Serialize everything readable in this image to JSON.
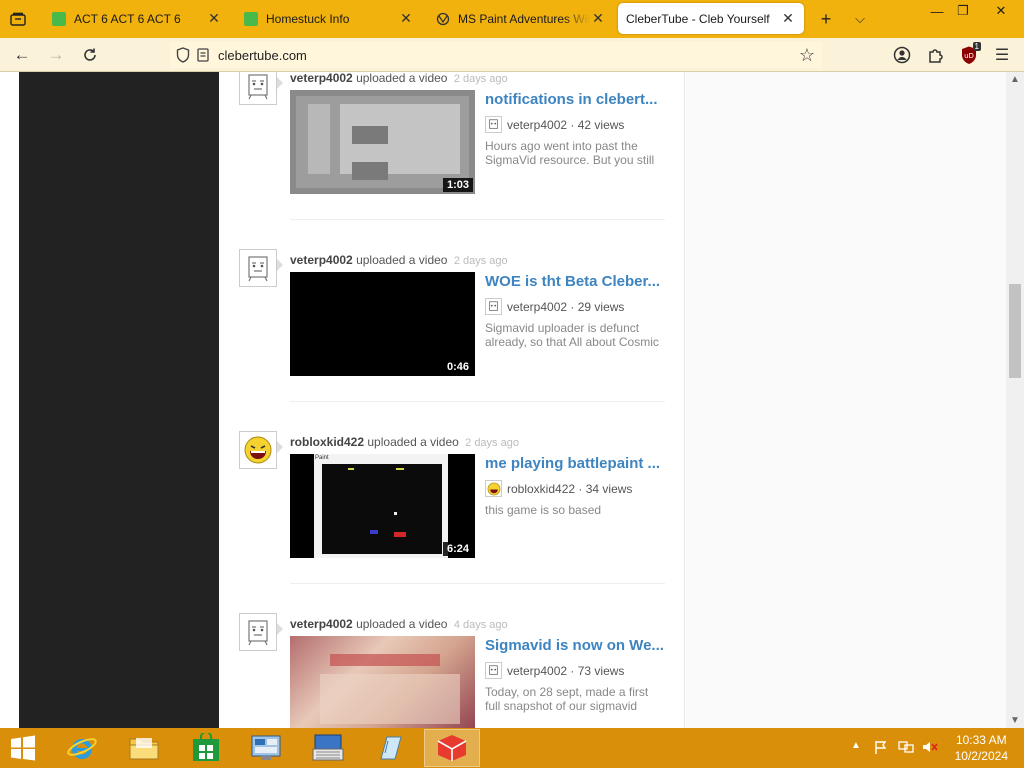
{
  "browser": {
    "tabs": [
      {
        "title": "ACT 6 ACT 6 ACT 6",
        "active": false
      },
      {
        "title": "Homestuck Info",
        "active": false
      },
      {
        "title": "MS Paint Adventures Wiki",
        "active": false
      },
      {
        "title": "CleberTube - Cleb Yourself",
        "active": true
      }
    ],
    "address": "clebertube.com",
    "extension_badge": "1",
    "extension_label": "uD"
  },
  "feed": {
    "action_text": "uploaded a video",
    "entries": [
      {
        "user": "veterp4002",
        "ago": "2 days ago",
        "title": "notifications in clebert...",
        "views": "42 views",
        "duration": "1:03",
        "desc": "Hours ago went into past the SigmaVid resource. But you still"
      },
      {
        "user": "veterp4002",
        "ago": "2 days ago",
        "title": "WOE is tht Beta Cleber...",
        "views": "29 views",
        "duration": "0:46",
        "desc": "Sigmavid uploader is defunct already, so that All about Cosmic"
      },
      {
        "user": "robloxkid422",
        "ago": "2 days ago",
        "title": "me playing battlepaint ...",
        "views": "34 views",
        "duration": "6:24",
        "desc": "this game is so based",
        "thumb_label": "Paint"
      },
      {
        "user": "veterp4002",
        "ago": "4 days ago",
        "title": "Sigmavid is now on We...",
        "views": "73 views",
        "duration": "",
        "desc": "Today, on 28 sept, made a first full snapshot of our sigmavid"
      }
    ]
  },
  "taskbar": {
    "time": "10:33 AM",
    "date": "10/2/2024"
  },
  "colors": {
    "tabbar": "#f2b20e",
    "taskbar": "#d98f0a",
    "link": "#3d84c0"
  }
}
